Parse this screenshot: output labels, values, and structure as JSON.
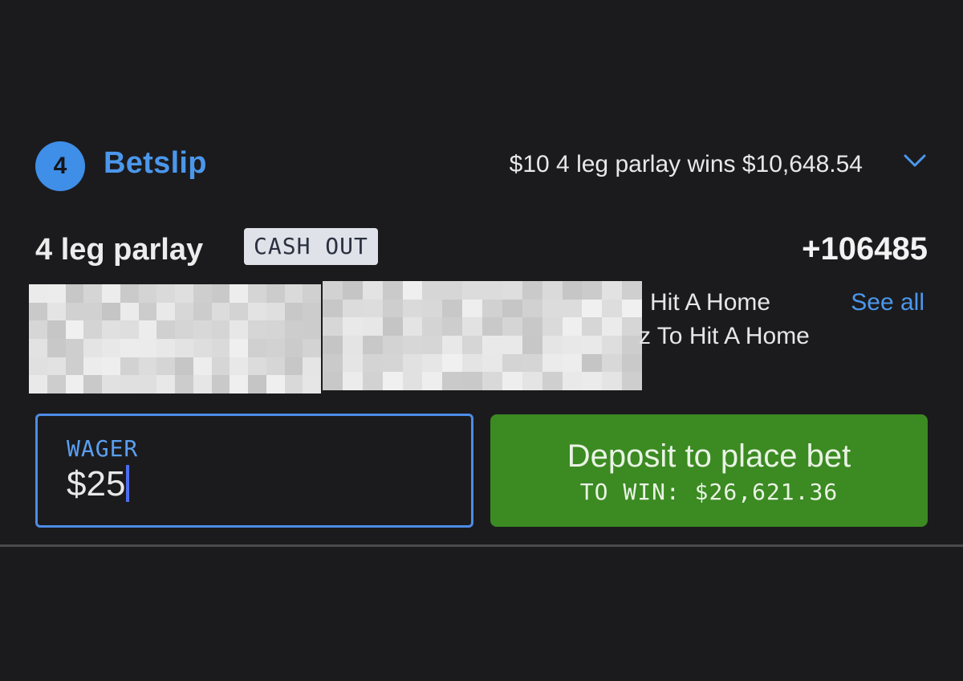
{
  "betslip": {
    "count": "4",
    "title": "Betslip",
    "summary": "$10 4 leg parlay wins $10,648.54"
  },
  "parlay": {
    "title": "4 leg parlay",
    "cashout_label": "CASH OUT",
    "odds": "+106485",
    "legs": [
      "Hit A Home",
      "z To Hit A Home"
    ],
    "see_all_label": "See all"
  },
  "wager": {
    "label": "WAGER",
    "value": "$25"
  },
  "deposit": {
    "label": "Deposit to place bet",
    "to_win": "TO WIN: $26,621.36"
  },
  "colors": {
    "background": "#1b1b1d",
    "accent_blue": "#4b97ec",
    "button_green": "#3b8a22",
    "cashout_bg": "#dfe2e8"
  },
  "icons": {
    "expand": "chevron-down-icon"
  }
}
